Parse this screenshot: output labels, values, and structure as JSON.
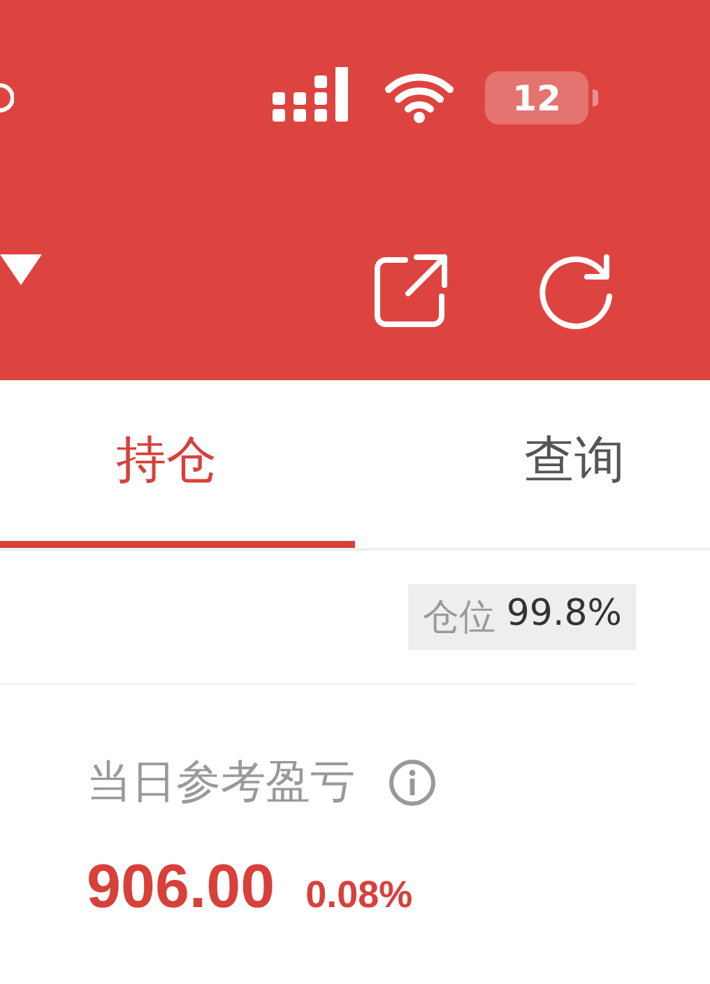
{
  "status_bar": {
    "battery": "12"
  },
  "tabs": [
    {
      "label": "持仓",
      "selected": true
    },
    {
      "label": "查询",
      "selected": false
    }
  ],
  "position_tag": {
    "label": "仓位",
    "value": "99.8%"
  },
  "pnl": {
    "title": "当日参考盈亏",
    "amount": "906.00",
    "percent": "0.08%"
  }
}
